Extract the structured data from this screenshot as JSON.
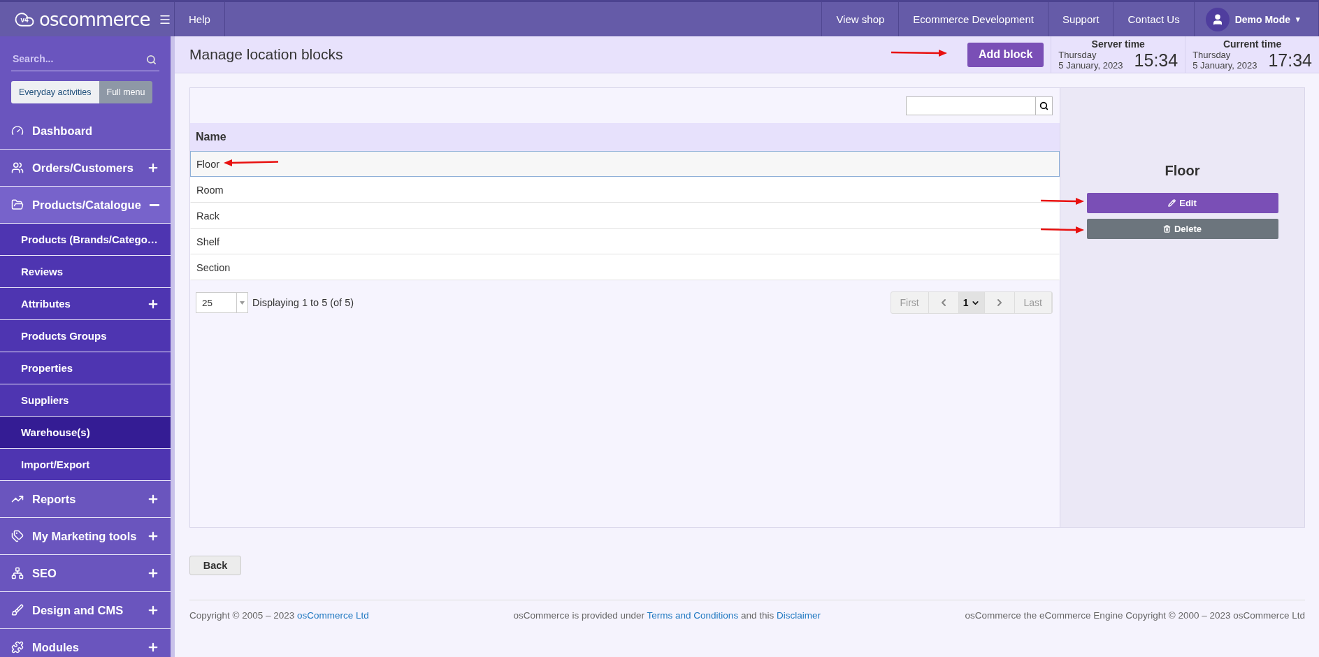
{
  "topbar": {
    "logo_badge": "v4",
    "logo": "oscommerce",
    "left_links": [
      {
        "label": "Help"
      }
    ],
    "right_links": [
      {
        "label": "View shop"
      },
      {
        "label": "Ecommerce Development"
      },
      {
        "label": "Support"
      },
      {
        "label": "Contact Us"
      }
    ],
    "user": "Demo Mode",
    "user_caret": "▾"
  },
  "sidebar": {
    "search": {
      "placeholder": "Search..."
    },
    "mode_tabs": [
      {
        "label": "Everyday activities",
        "selected": true
      },
      {
        "label": "Full menu",
        "selected": false
      }
    ],
    "items": [
      {
        "label": "Dashboard",
        "selected": false
      },
      {
        "label": "Orders/Customers",
        "expandable": true,
        "expanded": false,
        "selected": false
      },
      {
        "label": "Products/Catalogue",
        "expandable": true,
        "expanded": true,
        "selected": false,
        "children": [
          {
            "label": "Products (Brands/Catego…",
            "selected": false
          },
          {
            "label": "Reviews",
            "selected": false
          },
          {
            "label": "Attributes",
            "expandable": true,
            "expanded": false,
            "selected": false
          },
          {
            "label": "Products Groups",
            "selected": false
          },
          {
            "label": "Properties",
            "selected": false
          },
          {
            "label": "Suppliers",
            "selected": false
          },
          {
            "label": "Warehouse(s)",
            "selected": true
          },
          {
            "label": "Import/Export",
            "selected": false
          }
        ]
      },
      {
        "label": "Reports",
        "expandable": true,
        "expanded": false,
        "selected": false
      },
      {
        "label": "My Marketing tools",
        "expandable": true,
        "expanded": false,
        "selected": false
      },
      {
        "label": "SEO",
        "expandable": true,
        "expanded": false,
        "selected": false
      },
      {
        "label": "Design and CMS",
        "expandable": true,
        "expanded": false,
        "selected": false
      },
      {
        "label": "Modules",
        "expandable": true,
        "expanded": false,
        "selected": false
      }
    ]
  },
  "header": {
    "title": "Manage location blocks",
    "add_button": "Add block",
    "clocks": [
      {
        "label": "Server time",
        "day": "Thursday",
        "date": "5 January, 2023",
        "time": "15:34"
      },
      {
        "label": "Current time",
        "day": "Thursday",
        "date": "5 January, 2023",
        "time": "17:34"
      }
    ]
  },
  "table": {
    "column": "Name",
    "rows": [
      {
        "name": "Floor",
        "selected": true
      },
      {
        "name": "Room",
        "selected": false
      },
      {
        "name": "Rack",
        "selected": false
      },
      {
        "name": "Shelf",
        "selected": false
      },
      {
        "name": "Section",
        "selected": false
      }
    ],
    "page_size": "25",
    "displaying": "Displaying 1 to 5 (of 5)",
    "pager": {
      "first": {
        "label": "First",
        "disabled": true
      },
      "page": "1",
      "last": {
        "label": "Last",
        "disabled": true
      }
    }
  },
  "detail": {
    "title": "Floor",
    "actions": [
      {
        "label": "Edit",
        "kind": "edit"
      },
      {
        "label": "Delete",
        "kind": "delete"
      }
    ]
  },
  "back_button": "Back",
  "footer": {
    "left": {
      "text": "Copyright © 2005 – 2023",
      "link": "osCommerce Ltd"
    },
    "center": [
      {
        "text": "osCommerce is provided under"
      },
      {
        "link": "Terms and Conditions"
      },
      {
        "text": "and this"
      },
      {
        "link": "Disclaimer"
      }
    ],
    "right": "osCommerce the eCommerce Engine Copyright © 2000 – 2023 osCommerce Ltd"
  }
}
